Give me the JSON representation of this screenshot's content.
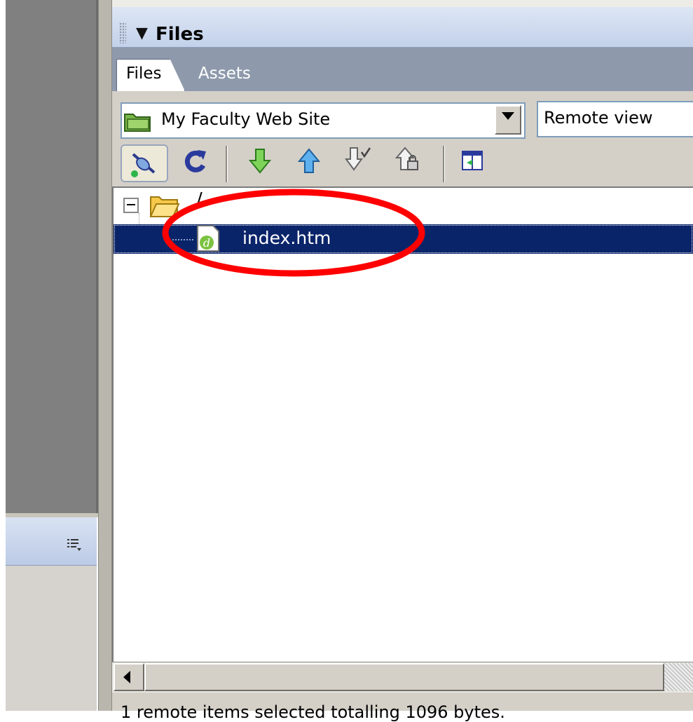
{
  "panel": {
    "title": "Files",
    "collapse_icon": "triangle-down-icon"
  },
  "tabs": [
    {
      "label": "Files",
      "active": true
    },
    {
      "label": "Assets",
      "active": false
    }
  ],
  "site_select": {
    "value": "My Faculty Web Site",
    "icon": "site-folder-icon"
  },
  "view_select": {
    "value": "Remote view"
  },
  "toolbar": {
    "icons": [
      "connect-icon",
      "refresh-icon",
      "get-icon",
      "put-icon",
      "check-out-icon",
      "check-in-icon",
      "expand-icon"
    ]
  },
  "tree": {
    "root_label": "/",
    "items": [
      {
        "label": "index.htm",
        "selected": true,
        "icon": "html-file-icon"
      }
    ]
  },
  "status": {
    "text": "1 remote items selected totalling 1096 bytes."
  },
  "colors": {
    "selection": "#0a246a",
    "annotation": "#ff0000",
    "panel_header": "#c3d1ea",
    "tab_strip": "#8e9aac"
  }
}
